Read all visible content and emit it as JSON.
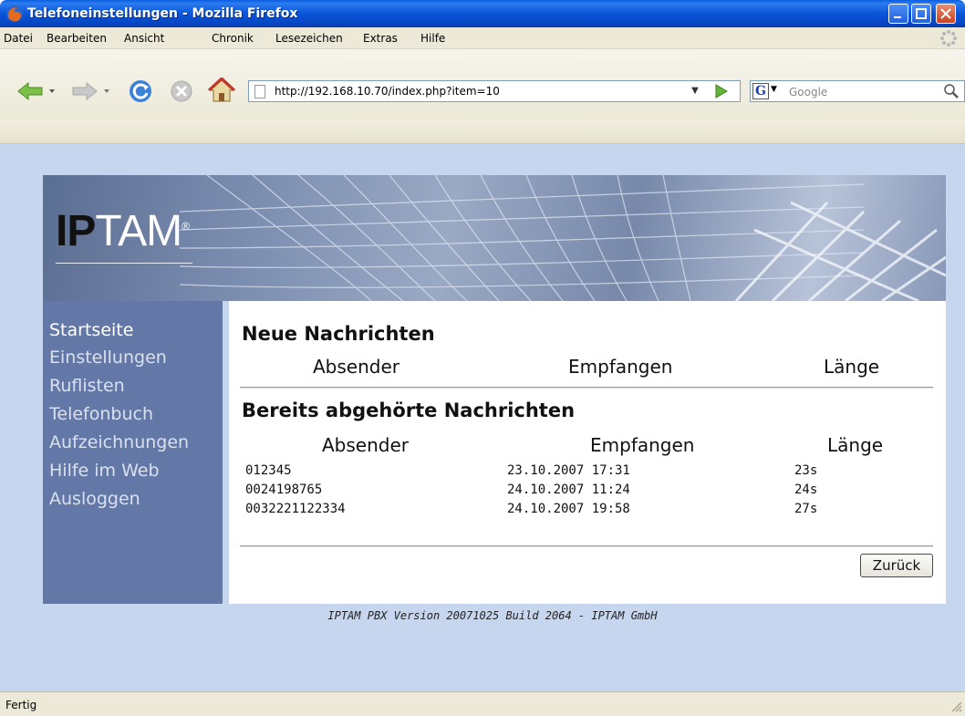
{
  "window": {
    "title": "Telefoneinstellungen - Mozilla Firefox"
  },
  "menu": [
    "Datei",
    "Bearbeiten",
    "Ansicht",
    "Chronik",
    "Lesezeichen",
    "Extras",
    "Hilfe"
  ],
  "toolbar": {
    "url": "http://192.168.10.70/index.php?item=10",
    "search_placeholder": "Google",
    "search_engine_icon": "G"
  },
  "banner": {
    "logo_prefix": "IP",
    "logo_suffix": "TAM",
    "logo_mark": "®"
  },
  "sidebar": {
    "items": [
      {
        "label": "Startseite"
      },
      {
        "label": "Einstellungen"
      },
      {
        "label": "Ruflisten"
      },
      {
        "label": "Telefonbuch"
      },
      {
        "label": "Aufzeichnungen"
      },
      {
        "label": "Hilfe im Web"
      },
      {
        "label": "Ausloggen"
      }
    ]
  },
  "new_messages": {
    "title": "Neue Nachrichten",
    "columns": [
      "Absender",
      "Empfangen",
      "Länge"
    ]
  },
  "old_messages": {
    "title": "Bereits abgehörte Nachrichten",
    "columns": [
      "Absender",
      "Empfangen",
      "Länge"
    ],
    "rows": [
      {
        "sender": "012345",
        "received": "23.10.2007 17:31",
        "length": "23s"
      },
      {
        "sender": "0024198765",
        "received": "24.10.2007 11:24",
        "length": "24s"
      },
      {
        "sender": "0032221122334",
        "received": "24.10.2007 19:58",
        "length": "27s"
      }
    ]
  },
  "buttons": {
    "back": "Zurück"
  },
  "footer": "IPTAM PBX Version 20071025 Build 2064 - IPTAM GmbH",
  "status": "Fertig",
  "colors": {
    "titlebar": "#0a55d8",
    "page_background": "#c7d6ef",
    "sidebar": "#6478a7"
  }
}
